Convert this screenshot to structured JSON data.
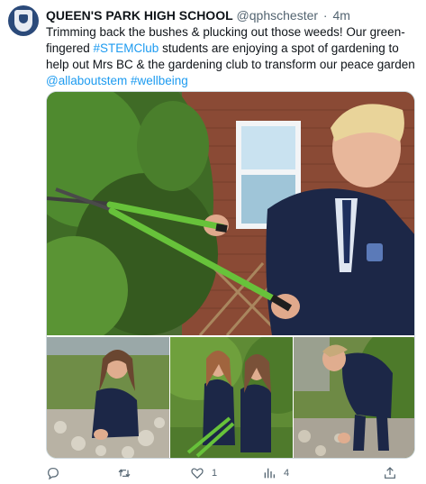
{
  "tweet": {
    "author_name": "QUEEN'S PARK HIGH SCHOOL",
    "handle": "@qphschester",
    "separator": "·",
    "time": "4m",
    "text_part1": "Trimming back the bushes & plucking out those weeds! Our green-fingered ",
    "hashtag_stem": "#STEMClub",
    "text_part2": " students are enjoying a spot of gardening to help out Mrs BC & the gardening club to transform our peace garden ",
    "mention": "@allaboutstem",
    "hashtag_wellbeing": "#wellbeing"
  },
  "media": {
    "photos": [
      {
        "name": "main",
        "subject": "student trimming bush with green-handled shears"
      },
      {
        "name": "bottom-left",
        "subject": "student kneeling by rocks"
      },
      {
        "name": "bottom-middle",
        "subject": "two students with shears"
      },
      {
        "name": "bottom-right",
        "subject": "student pulling weeds"
      }
    ]
  },
  "actions": {
    "reply": {
      "icon": "reply-icon",
      "count": ""
    },
    "retweet": {
      "icon": "retweet-icon",
      "count": ""
    },
    "like": {
      "icon": "heart-icon",
      "count": "1"
    },
    "views": {
      "icon": "views-icon",
      "count": "4"
    },
    "share": {
      "icon": "share-icon",
      "count": ""
    }
  },
  "colors": {
    "link": "#1d9bf0",
    "secondary_text": "#536471",
    "primary_text": "#0f1419",
    "border": "#cfd9de"
  }
}
